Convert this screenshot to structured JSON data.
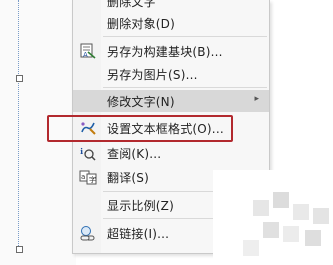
{
  "menu": {
    "items": [
      {
        "label": "删除文字",
        "icon": "none"
      },
      {
        "label": "删除对象(D)",
        "icon": "none"
      },
      {
        "label": "另存为构建基块(B)...",
        "icon": "building-block-icon"
      },
      {
        "label": "另存为图片(S)...",
        "icon": "none"
      },
      {
        "label": "修改文字(N)",
        "icon": "none",
        "submenu": true
      },
      {
        "label": "设置文本框格式(O)...",
        "icon": "format-textbox-icon"
      },
      {
        "label": "查阅(K)...",
        "icon": "lookup-icon"
      },
      {
        "label": "翻译(S)",
        "icon": "translate-icon"
      },
      {
        "label": "显示比例(Z)",
        "icon": "none"
      },
      {
        "label": "超链接(I)...",
        "icon": "hyperlink-icon"
      }
    ],
    "submenu_arrow": "▸",
    "highlight_color": "#b2292e"
  }
}
